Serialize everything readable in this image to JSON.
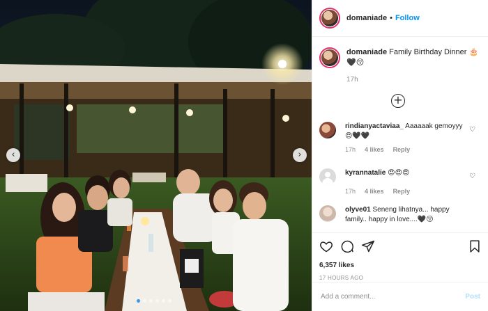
{
  "header": {
    "username": "domaniade",
    "separator": "•",
    "follow_label": "Follow"
  },
  "caption": {
    "username": "domaniade",
    "text": "Family Birthday Dinner 🎂🖤😚",
    "time": "17h"
  },
  "add_icon": "plus-circle-icon",
  "comments": [
    {
      "username": "rindianyactaviaa_",
      "text": "Aaaaaak gemoyyy😍🖤🖤",
      "time": "17h",
      "likes": "4 likes",
      "reply_label": "Reply",
      "avatar_color": "#8a4a3a"
    },
    {
      "username": "kyrannatalie",
      "text": "😍😍😍",
      "time": "17h",
      "likes": "4 likes",
      "reply_label": "Reply",
      "avatar_color": "#dbdbdb"
    },
    {
      "username": "olyve01",
      "text": "Seneng lihatnya... happy family.. happy in love....🖤😚",
      "time": "",
      "likes": "",
      "reply_label": "",
      "avatar_color": "#d9cfc8"
    }
  ],
  "actions": {
    "like_icon": "heart-icon",
    "comment_icon": "comment-icon",
    "share_icon": "share-icon",
    "save_icon": "bookmark-icon",
    "likes_count": "6,357 likes",
    "post_time": "17 HOURS AGO"
  },
  "add_comment": {
    "placeholder": "Add a comment...",
    "post_label": "Post"
  },
  "photo": {
    "description_icon": "carousel-photo",
    "prev_icon": "chevron-left-icon",
    "next_icon": "chevron-right-icon",
    "prev_glyph": "‹",
    "next_glyph": "›",
    "slide_count": 6,
    "active_slide": 1
  },
  "colors": {
    "follow": "#0095f6",
    "story_ring": "#e1306c",
    "post_disabled": "#b2dffc",
    "active_dot": "#3897f0"
  }
}
